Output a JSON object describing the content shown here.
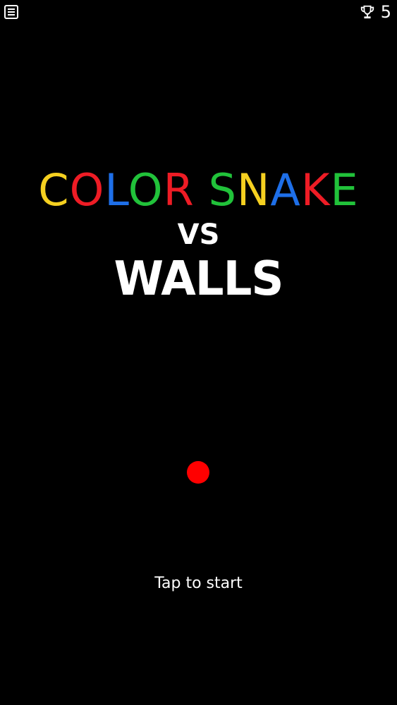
{
  "topbar": {
    "menu_icon": "menu-icon",
    "trophy_icon": "trophy-icon",
    "best_score": "5"
  },
  "title": {
    "line1": [
      {
        "char": "C",
        "color": "#F5D020"
      },
      {
        "char": "O",
        "color": "#EE1C25"
      },
      {
        "char": "L",
        "color": "#1E6FE8"
      },
      {
        "char": "O",
        "color": "#21C23A"
      },
      {
        "char": "R",
        "color": "#EE1C25"
      },
      {
        "char": " ",
        "color": "#FFFFFF"
      },
      {
        "char": "S",
        "color": "#21C23A"
      },
      {
        "char": "N",
        "color": "#F5D020"
      },
      {
        "char": "A",
        "color": "#1E6FE8"
      },
      {
        "char": "K",
        "color": "#EE1C25"
      },
      {
        "char": "E",
        "color": "#21C23A"
      }
    ],
    "line2": "VS",
    "line3": "WALLS"
  },
  "snake": {
    "head_color": "#FF0000"
  },
  "prompt": "Tap to start",
  "colors": {
    "background": "#000000",
    "text": "#FFFFFF"
  }
}
